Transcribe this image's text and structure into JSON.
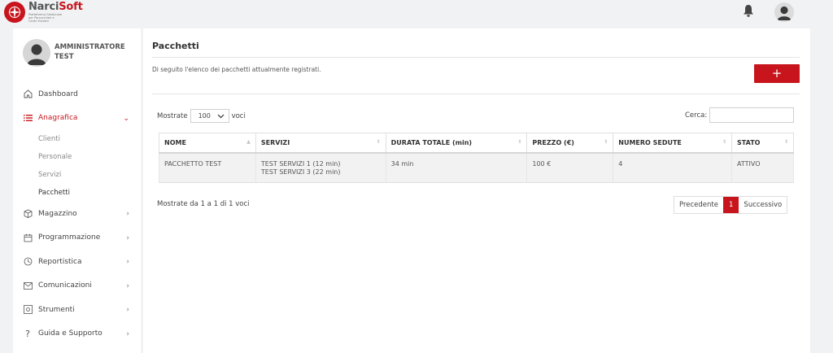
{
  "brand": {
    "name_part1": "Narci",
    "name_part2": "Soft",
    "tagline": "Piattaforma Gestionale per Parrucchieri e Centri Estetici"
  },
  "user": {
    "name": "AMMINISTRATORE TEST"
  },
  "sidebar": {
    "items": [
      {
        "label": "Dashboard",
        "icon": "home-icon"
      },
      {
        "label": "Anagrafica",
        "icon": "list-icon",
        "expanded": true
      },
      {
        "label": "Magazzino",
        "icon": "box-icon"
      },
      {
        "label": "Programmazione",
        "icon": "calendar-icon"
      },
      {
        "label": "Reportistica",
        "icon": "clock-icon"
      },
      {
        "label": "Comunicazioni",
        "icon": "mail-icon"
      },
      {
        "label": "Strumenti",
        "icon": "settings-box-icon"
      },
      {
        "label": "Guida e Supporto",
        "icon": "question-icon"
      }
    ],
    "subitems": [
      "Clienti",
      "Personale",
      "Servizi",
      "Pacchetti"
    ]
  },
  "main": {
    "title": "Pacchetti",
    "description": "Di seguito l'elenco dei pacchetti attualmente registrati.",
    "add_label": "+",
    "show_prefix": "Mostrate",
    "page_size": "100",
    "show_suffix": "voci",
    "search_label": "Cerca:",
    "search_value": "",
    "columns": [
      "NOME",
      "SERVIZI",
      "DURATA TOTALE (min)",
      "PREZZO (€)",
      "NUMERO SEDUTE",
      "STATO"
    ],
    "rows": [
      {
        "nome": "PACCHETTO TEST",
        "servizi_1": "TEST SERVIZI 1 (12 min)",
        "servizi_2": "TEST SERVIZI 3 (22 min)",
        "durata": "34 min",
        "prezzo": "100 €",
        "sedute": "4",
        "stato": "ATTIVO"
      }
    ],
    "info": "Mostrate da 1 a 1 di 1 voci",
    "pager": {
      "prev": "Precedente",
      "current": "1",
      "next": "Successivo"
    }
  },
  "colors": {
    "accent": "#c8151d"
  }
}
